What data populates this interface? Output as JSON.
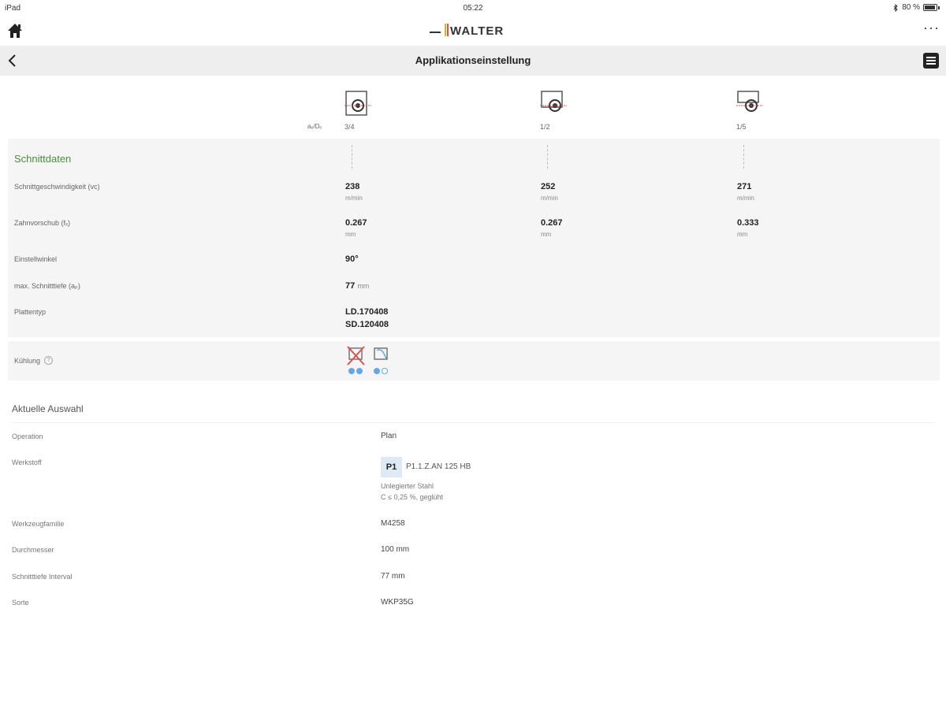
{
  "status_bar": {
    "device": "iPad",
    "time": "05:22",
    "battery": "80 %",
    "bluetooth_icon": "bluetooth-icon"
  },
  "header": {
    "logo_text": "WALTER",
    "home_icon": "home-icon",
    "more_icon": "more-icon",
    "more_symbol": "···"
  },
  "nav": {
    "title": "Applikationseinstellung",
    "back_icon": "back-chevron-icon",
    "menu_icon": "list-menu-icon"
  },
  "ratio_label": "aₑ/Dₑ",
  "columns": [
    {
      "ratio": "3/4",
      "icon": "engagement-icon"
    },
    {
      "ratio": "1/2",
      "icon": "engagement-icon"
    },
    {
      "ratio": "1/5",
      "icon": "engagement-icon"
    }
  ],
  "cutting_data": {
    "title": "Schnittdaten",
    "cutting_speed": {
      "label": "Schnittgeschwindigkeit (vᴄ)",
      "values": [
        "238",
        "252",
        "271"
      ],
      "unit": "m/min"
    },
    "feed_per_tooth": {
      "label": "Zahnvorschub (fₓ)",
      "values": [
        "0.267",
        "0.267",
        "0.333"
      ],
      "unit": "mm"
    },
    "approach_angle": {
      "label": "Einstellwinkel",
      "value": "90°"
    },
    "max_depth": {
      "label": "max. Schnitttiefe (aₚ)",
      "value": "77",
      "unit": "mm"
    },
    "insert_type": {
      "label": "Plattentyp",
      "values": [
        "LD.170408",
        "SD.120408"
      ]
    }
  },
  "cooling": {
    "label": "Kühlung",
    "help_symbol": "?",
    "options": [
      {
        "icon": "dry-cooling-crossed-icon",
        "dots": [
          true,
          true
        ]
      },
      {
        "icon": "coolant-icon",
        "dots": [
          true,
          false
        ]
      }
    ]
  },
  "selection": {
    "title": "Aktuelle Auswahl",
    "operation": {
      "label": "Operation",
      "value": "Plan"
    },
    "material": {
      "label": "Werkstoff",
      "badge": "P1",
      "code": "P1.1.Z.AN   125 HB",
      "desc1": "Unlegierter Stahl",
      "desc2": "C ≤ 0,25 %, geglüht"
    },
    "tool_family": {
      "label": "Werkzeugfamilie",
      "value": "M4258"
    },
    "diameter": {
      "label": "Durchmesser",
      "value": "100 mm"
    },
    "depth_interval": {
      "label": "Schnitttiefe Interval",
      "value": "77 mm"
    },
    "grade": {
      "label": "Sorte",
      "value": "WKP35G"
    }
  },
  "colors": {
    "accent_green": "#4a8d3c",
    "dot_blue": "#62a8e8",
    "badge_bg": "#dde9f5",
    "icon_red": "#d9534f"
  }
}
